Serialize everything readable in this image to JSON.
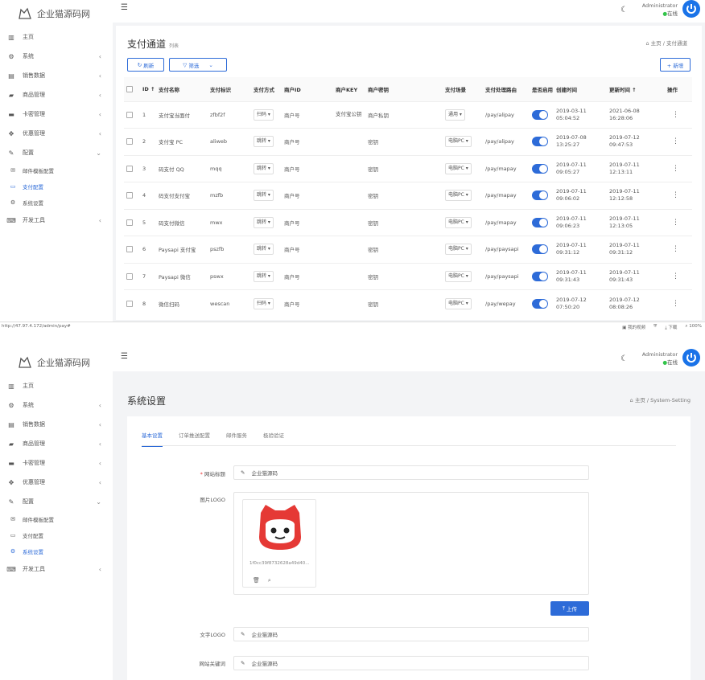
{
  "app": {
    "logo_text": "企业猫源码网"
  },
  "header": {
    "user_name": "Administrator",
    "user_status": "在线"
  },
  "sidebar": {
    "items": [
      {
        "label": "主页",
        "icon": "dashboard-icon",
        "chevron": false
      },
      {
        "label": "系统",
        "icon": "gear-icon",
        "chevron": true
      },
      {
        "label": "销售数据",
        "icon": "chart-icon",
        "chevron": true
      },
      {
        "label": "商品管理",
        "icon": "box-icon",
        "chevron": true
      },
      {
        "label": "卡密管理",
        "icon": "card-icon",
        "chevron": true
      },
      {
        "label": "优惠管理",
        "icon": "coupon-icon",
        "chevron": true
      },
      {
        "label": "配置",
        "icon": "wrench-icon",
        "chevron": true,
        "expanded": true
      }
    ],
    "sub_items": [
      {
        "label": "邮件模板配置",
        "icon": "mail-icon"
      },
      {
        "label": "支付配置",
        "icon": "payment-icon"
      },
      {
        "label": "系统设置",
        "icon": "settings-icon"
      }
    ],
    "dev_tools": {
      "label": "开发工具",
      "icon": "dev-icon"
    }
  },
  "pay_page": {
    "title": "支付通道",
    "subtitle": "列表",
    "breadcrumb": "主页 / 支付通道",
    "refresh_label": "刷新",
    "filter_label": "筛选",
    "add_label": "+ 新增",
    "columns": [
      "ID ↑",
      "支付名称",
      "支付标识",
      "支付方式",
      "商户ID",
      "商户KEY",
      "商户密钥",
      "支付场景",
      "支付处理路由",
      "是否启用",
      "创建时间",
      "更新时间 ↑",
      "操作"
    ],
    "rows": [
      {
        "id": "1",
        "name": "支付宝当面付",
        "tag": "zfbf2f",
        "method": "扫码",
        "merchant_id": "商户号",
        "merchant_key": "支付宝公钥",
        "secret": "商户私钥",
        "scene": "通用",
        "route": "/pay/alipay",
        "created": [
          "2019-03-11",
          "05:04:52"
        ],
        "updated": [
          "2021-06-08",
          "16:28:06"
        ]
      },
      {
        "id": "2",
        "name": "支付宝 PC",
        "tag": "aliweb",
        "method": "跳转",
        "merchant_id": "商户号",
        "merchant_key": "",
        "secret": "密钥",
        "scene": "电脑PC",
        "route": "/pay/alipay",
        "created": [
          "2019-07-08",
          "13:25:27"
        ],
        "updated": [
          "2019-07-12",
          "09:47:53"
        ]
      },
      {
        "id": "3",
        "name": "码支付 QQ",
        "tag": "mqq",
        "method": "跳转",
        "merchant_id": "商户号",
        "merchant_key": "",
        "secret": "密钥",
        "scene": "电脑PC",
        "route": "/pay/mapay",
        "created": [
          "2019-07-11",
          "09:05:27"
        ],
        "updated": [
          "2019-07-11",
          "12:13:11"
        ]
      },
      {
        "id": "4",
        "name": "码支付支付宝",
        "tag": "mzfb",
        "method": "跳转",
        "merchant_id": "商户号",
        "merchant_key": "",
        "secret": "密钥",
        "scene": "电脑PC",
        "route": "/pay/mapay",
        "created": [
          "2019-07-11",
          "09:06:02"
        ],
        "updated": [
          "2019-07-11",
          "12:12:58"
        ]
      },
      {
        "id": "5",
        "name": "码支付微信",
        "tag": "mwx",
        "method": "跳转",
        "merchant_id": "商户号",
        "merchant_key": "",
        "secret": "密钥",
        "scene": "电脑PC",
        "route": "/pay/mapay",
        "created": [
          "2019-07-11",
          "09:06:23"
        ],
        "updated": [
          "2019-07-11",
          "12:13:05"
        ]
      },
      {
        "id": "6",
        "name": "Paysapi 支付宝",
        "tag": "pszfb",
        "method": "跳转",
        "merchant_id": "商户号",
        "merchant_key": "",
        "secret": "密钥",
        "scene": "电脑PC",
        "route": "/pay/paysapi",
        "created": [
          "2019-07-11",
          "09:31:12"
        ],
        "updated": [
          "2019-07-11",
          "09:31:12"
        ]
      },
      {
        "id": "7",
        "name": "Paysapi 微信",
        "tag": "pswx",
        "method": "跳转",
        "merchant_id": "商户号",
        "merchant_key": "",
        "secret": "密钥",
        "scene": "电脑PC",
        "route": "/pay/paysapi",
        "created": [
          "2019-07-11",
          "09:31:43"
        ],
        "updated": [
          "2019-07-11",
          "09:31:43"
        ]
      },
      {
        "id": "8",
        "name": "微信扫码",
        "tag": "wescan",
        "method": "扫码",
        "merchant_id": "商户号",
        "merchant_key": "",
        "secret": "密钥",
        "scene": "电脑PC",
        "route": "/pay/wepay",
        "created": [
          "2019-07-12",
          "07:50:20"
        ],
        "updated": [
          "2019-07-12",
          "08:08:26"
        ]
      }
    ]
  },
  "statusbar": {
    "url": "http://47.97.4.172/admin/pay#",
    "video_label": "我的视频",
    "download_label": "下载",
    "zoom": "100%"
  },
  "settings_page": {
    "title": "系统设置",
    "breadcrumb": "主页 / System-Setting",
    "tabs": [
      "基本设置",
      "订单推送配置",
      "邮件服务",
      "极验验证"
    ],
    "site_title_label": "网站标题",
    "site_title_value": "企业猫源码",
    "logo_label": "图片LOGO",
    "logo_filename": "1f0cc39f8732628a49d40...",
    "upload_label": "上传",
    "text_logo_label": "文字LOGO",
    "text_logo_value": "企业猫源码",
    "keywords_label": "网站关键词",
    "keywords_value": "企业猫源码"
  }
}
